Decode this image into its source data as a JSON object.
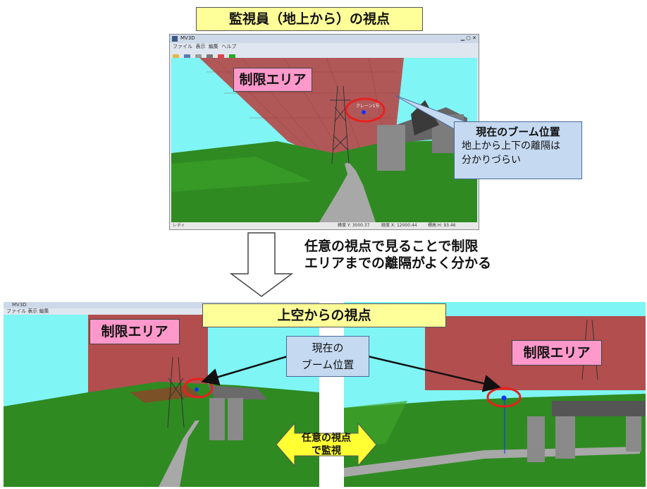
{
  "top_title": "監視員（地上から）の視点",
  "top_window": {
    "app_title": "MV3D",
    "menu": [
      "ファイル",
      "表示",
      "編集",
      "ヘルプ"
    ],
    "restricted_label": "制限エリア",
    "crane_marker": "クレーン1号",
    "status_left": "レディ",
    "status_items": [
      "緯度 Y: 3000.37",
      "経度 X: 12000.44",
      "標高 H: 93.46"
    ]
  },
  "callout_top": {
    "title": "現在のブーム位置",
    "line1": "地上から上下の離隔は",
    "line2": "分かりづらい"
  },
  "arrow_text": {
    "line1": "任意の視点で見ることで制限",
    "line2": "エリアまでの離隔がよく分かる"
  },
  "bottom_title": "上空からの視点",
  "bottom_left": {
    "restricted_label": "制限エリア",
    "menu": [
      "ファイル",
      "表示",
      "編集"
    ]
  },
  "bottom_right": {
    "restricted_label": "制限エリア"
  },
  "boom_callout": {
    "line1": "現在の",
    "line2": "ブーム位置"
  },
  "monitor_label": {
    "line1": "任意の視点",
    "line2": "で監視"
  },
  "colors": {
    "sky": "#7ff5f5",
    "grass": "#2f8a22",
    "restricted_zone": "#b83c3c",
    "title_yellow": "#ffff99",
    "label_pink": "#ff99cc",
    "callout_blue": "#c5d9f1",
    "marker_red": "#e8201e",
    "boom_blue": "#1030ff"
  }
}
